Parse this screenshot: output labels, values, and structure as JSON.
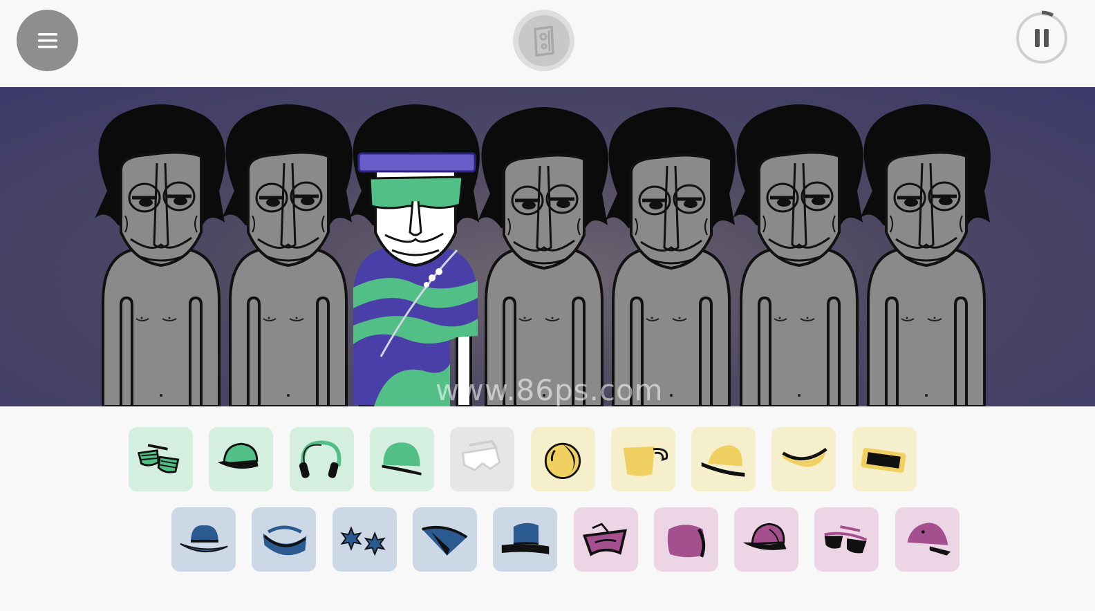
{
  "watermark": "www.86ps.com",
  "colors": {
    "green": "#52bf86",
    "green_tile": "#d4eee0",
    "white_tile": "#e6e6e6",
    "yellow": "#f0d060",
    "yellow_tile": "#f6efcc",
    "blue": "#2a5a8f",
    "blue_tile": "#ccd8e6",
    "purple": "#a44f8e",
    "purple_tile": "#ecd6e6",
    "stage_top": "#3c3a6a",
    "body_gray": "#8a8a8a"
  },
  "header": {
    "menu_icon": "hamburger-icon",
    "center_icon": "speaker-icon",
    "play_state_icon": "pause-icon"
  },
  "stage": {
    "character_count": 7,
    "dressed_slot": 3
  },
  "items_row1": [
    {
      "icon": "shutter-shades-icon",
      "color": "green"
    },
    {
      "icon": "cap-icon",
      "color": "green"
    },
    {
      "icon": "headphones-icon",
      "color": "green"
    },
    {
      "icon": "beanie-icon",
      "color": "green"
    },
    {
      "icon": "visor-glasses-icon",
      "color": "white"
    },
    {
      "icon": "ball-icon",
      "color": "yellow"
    },
    {
      "icon": "cup-icon",
      "color": "yellow"
    },
    {
      "icon": "bowl-hat-icon",
      "color": "yellow"
    },
    {
      "icon": "headband-icon",
      "color": "yellow"
    },
    {
      "icon": "bar-glasses-icon",
      "color": "yellow"
    }
  ],
  "items_row2": [
    {
      "icon": "fedora-icon",
      "color": "blue"
    },
    {
      "icon": "sweatband-icon",
      "color": "blue"
    },
    {
      "icon": "star-glasses-icon",
      "color": "blue"
    },
    {
      "icon": "triangle-hat-icon",
      "color": "blue"
    },
    {
      "icon": "top-hat-icon",
      "color": "blue"
    },
    {
      "icon": "crown-icon",
      "color": "purple"
    },
    {
      "icon": "round-hat-icon",
      "color": "purple"
    },
    {
      "icon": "baseball-cap-icon",
      "color": "purple"
    },
    {
      "icon": "sunglasses-icon",
      "color": "purple"
    },
    {
      "icon": "bucket-hat-icon",
      "color": "purple"
    }
  ]
}
